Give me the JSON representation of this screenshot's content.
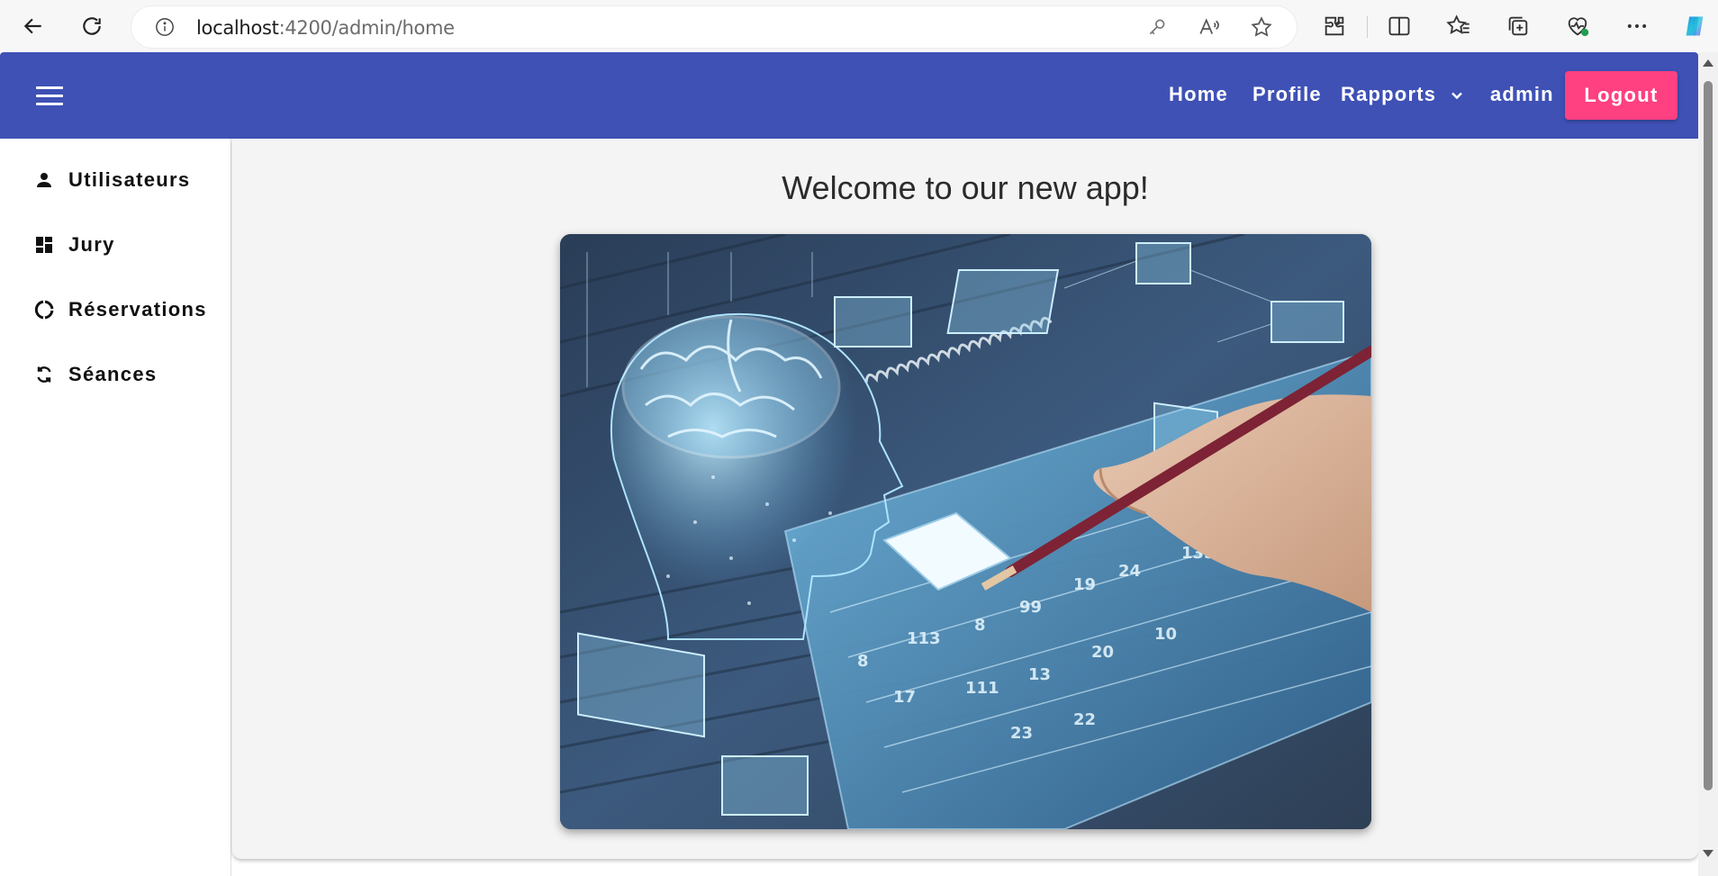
{
  "browser": {
    "url_host": "localhost",
    "url_rest": ":4200/admin/home",
    "icons": [
      "back-icon",
      "refresh-icon",
      "info-icon",
      "key-icon",
      "read-aloud-icon",
      "favorite-star-icon",
      "extensions-icon",
      "split-screen-icon",
      "favorites-icon",
      "collections-icon",
      "browser-essentials-icon",
      "more-icon",
      "copilot-icon"
    ]
  },
  "topbar": {
    "nav": {
      "home": "Home",
      "profile": "Profile",
      "rapports": "Rapports",
      "user": "admin"
    },
    "logout_label": "Logout",
    "colors": {
      "bar": "#3f51b5",
      "logout": "#ff4081"
    }
  },
  "sidebar": {
    "items": [
      {
        "label": "Utilisateurs",
        "icon": "person-icon"
      },
      {
        "label": "Jury",
        "icon": "dashboard-icon"
      },
      {
        "label": "Réservations",
        "icon": "donut-icon"
      },
      {
        "label": "Séances",
        "icon": "sync-icon"
      }
    ]
  },
  "main": {
    "title": "Welcome to our new app!",
    "hero_image": "brain-calendar-illustration"
  }
}
